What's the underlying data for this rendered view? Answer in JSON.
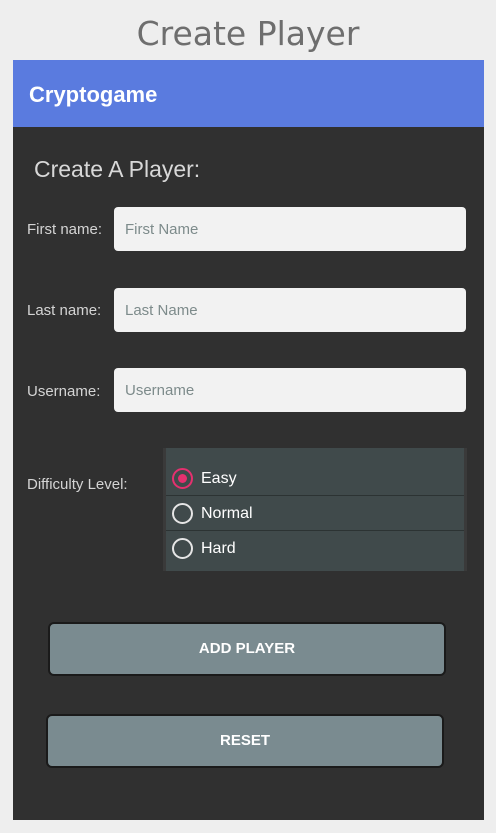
{
  "page": {
    "title": "Create Player"
  },
  "app_bar": {
    "title": "Cryptogame",
    "color": "#5a7bdf"
  },
  "form": {
    "heading": "Create A Player:",
    "fields": [
      {
        "label": "First name:",
        "placeholder": "First Name",
        "value": ""
      },
      {
        "label": "Last name:",
        "placeholder": "Last Name",
        "value": ""
      },
      {
        "label": "Username:",
        "placeholder": "Username",
        "value": ""
      }
    ],
    "difficulty": {
      "label": "Difficulty Level:",
      "options": [
        "Easy",
        "Normal",
        "Hard"
      ],
      "selected": "Easy",
      "accent_color": "#e5306f"
    }
  },
  "buttons": {
    "add_player": "ADD PLAYER",
    "reset": "RESET"
  }
}
